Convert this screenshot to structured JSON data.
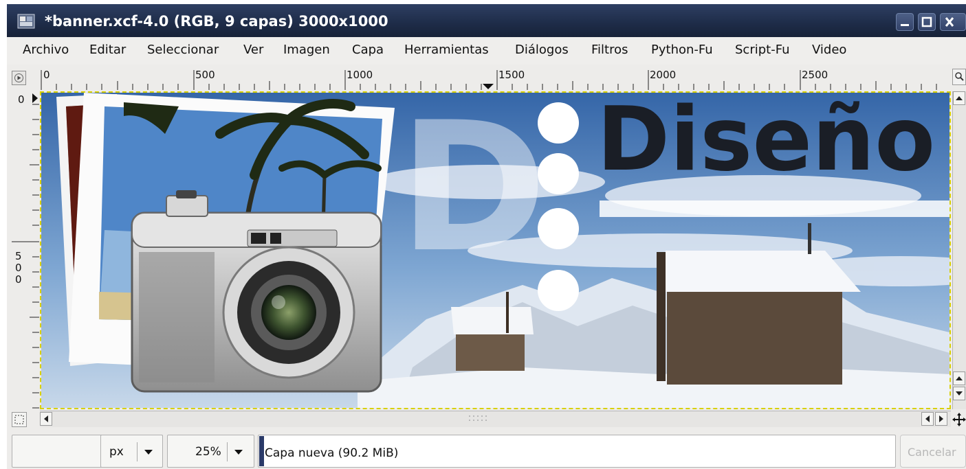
{
  "window": {
    "title": "*banner.xcf-4.0 (RGB, 9 capas) 3000x1000",
    "controls": [
      "minimize",
      "maximize",
      "close"
    ]
  },
  "menubar": {
    "items": [
      {
        "label": "Archivo"
      },
      {
        "label": "Editar"
      },
      {
        "label": "Seleccionar"
      },
      {
        "label": "Ver"
      },
      {
        "label": "Imagen"
      },
      {
        "label": "Capa"
      },
      {
        "label": "Herramientas"
      },
      {
        "label": "Diálogos"
      },
      {
        "label": "Filtros"
      },
      {
        "label": "Python-Fu"
      },
      {
        "label": "Script-Fu"
      },
      {
        "label": "Video"
      }
    ]
  },
  "rulers": {
    "horizontal_labels": [
      "0",
      "500",
      "1000",
      "1500",
      "2000",
      "2500"
    ],
    "vertical_top_label": "0",
    "vertical_mid_label": [
      "5",
      "0",
      "0"
    ]
  },
  "canvas": {
    "banner_text": "Diseño",
    "big_letter": "D"
  },
  "status": {
    "unit": "px",
    "zoom": "25%",
    "message": "Capa nueva (90.2 MiB)",
    "cancel_label": "Cancelar"
  },
  "colors": {
    "titlebar": "#1f2d4a",
    "menubar_bg": "#efeeec",
    "selection_border": "#d8d000",
    "sky": "#3f73b3",
    "snow": "#f1f4f8"
  }
}
